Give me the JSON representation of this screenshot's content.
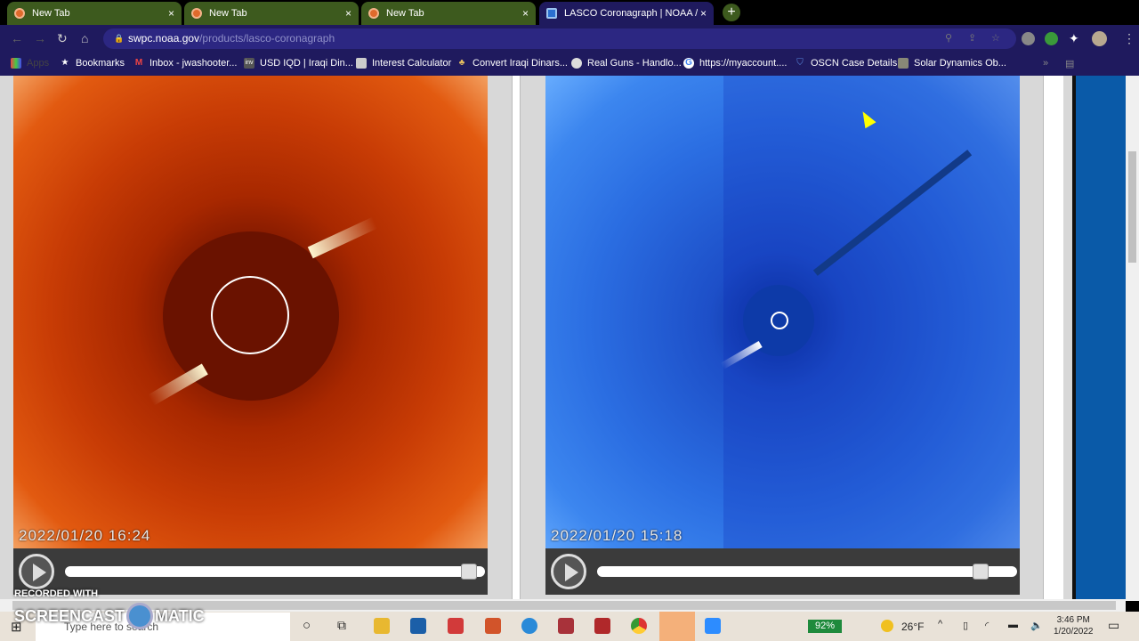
{
  "tabs": [
    {
      "label": "New Tab",
      "close": "×"
    },
    {
      "label": "New Tab",
      "close": "×"
    },
    {
      "label": "New Tab",
      "close": "×"
    },
    {
      "label": "LASCO Coronagraph | NOAA / N",
      "close": "×",
      "active": true
    }
  ],
  "new_tab": "+",
  "address": {
    "domain": "swpc.noaa.gov",
    "path": "/products/lasco-coronagraph"
  },
  "bookmarks": [
    {
      "label": "Apps"
    },
    {
      "label": "Bookmarks"
    },
    {
      "label": "Inbox - jwashooter..."
    },
    {
      "label": "USD IQD | Iraqi Din..."
    },
    {
      "label": "Interest Calculator"
    },
    {
      "label": "Convert Iraqi Dinars..."
    },
    {
      "label": "Real Guns - Handlo..."
    },
    {
      "label": "https://myaccount...."
    },
    {
      "label": "OSCN Case Details"
    },
    {
      "label": "Solar Dynamics Ob..."
    }
  ],
  "panels": [
    {
      "timestamp": "2022/01/20  16:24",
      "progress": 0.98,
      "theme": "C2 red"
    },
    {
      "timestamp": "2022/01/20  15:18",
      "progress": 0.93,
      "theme": "C3 blue"
    }
  ],
  "watermark": {
    "line1": "RECORDED WITH",
    "line2": "SCREENCAST",
    "line3": "MATIC"
  },
  "taskbar": {
    "search_placeholder": "Type here to search",
    "battery": "92%",
    "weather": "26°F",
    "time": "3:46 PM",
    "date": "1/20/2022"
  }
}
